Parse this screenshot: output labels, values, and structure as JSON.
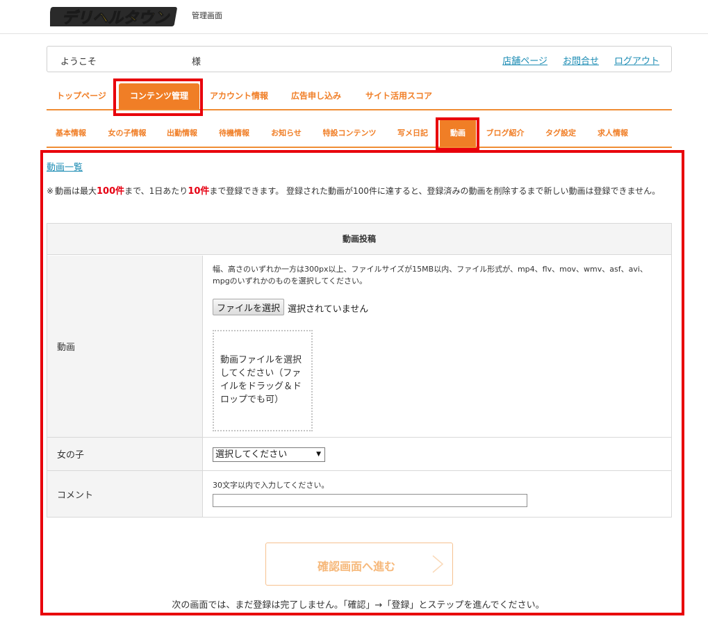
{
  "header": {
    "logo_text": "デリヘルタウン",
    "title": "管理画面"
  },
  "welcome": {
    "label": "ようこそ",
    "suffix": "様",
    "links": [
      "店舗ページ",
      "お問合せ",
      "ログアウト"
    ]
  },
  "main_tabs": [
    "トップページ",
    "コンテンツ管理",
    "アカウント情報",
    "広告申し込み",
    "サイト活用スコア"
  ],
  "main_tabs_active": "コンテンツ管理",
  "sub_tabs": [
    "基本情報",
    "女の子情報",
    "出勤情報",
    "待機情報",
    "お知らせ",
    "特設コンテンツ",
    "写メ日記",
    "動画",
    "ブログ紹介",
    "タグ設定",
    "求人情報"
  ],
  "sub_tabs_active": "動画",
  "content": {
    "list_link": "動画一覧",
    "notice": {
      "mark": "※",
      "part1": "動画は最大",
      "max_count": "100件",
      "part2": "まで、1日あたり",
      "daily_count": "10件",
      "part3": "まで登録できます。 登録された動画が100件に達すると、登録済みの動画を削除するまで新しい動画は登録できません。"
    },
    "form": {
      "title": "動画投稿",
      "video": {
        "label": "動画",
        "help": "幅、高さのいずれか一方は300px以上、ファイルサイズが15MB以内、ファイル形式が、mp4、flv、mov、wmv、asf、avi、mpgのいずれかのものを選択してください。",
        "file_button": "ファイルを選択",
        "file_status": "選択されていません",
        "dropzone_text": "動画ファイルを選択してください（ファイルをドラッグ＆ドロップでも可）"
      },
      "girl": {
        "label": "女の子",
        "select_value": "選択してください"
      },
      "comment": {
        "label": "コメント",
        "help": "30文字以内で入力してください。",
        "value": ""
      }
    },
    "confirm_button": "確認画面へ進む",
    "footnote": "次の画面では、まだ登録は完了しません。「確認」→「登録」とステップを進んでください。"
  },
  "colors": {
    "accent": "#f07e26",
    "link": "#1a8bb3",
    "highlight": "#e8000b",
    "notice_red": "#e60012"
  }
}
